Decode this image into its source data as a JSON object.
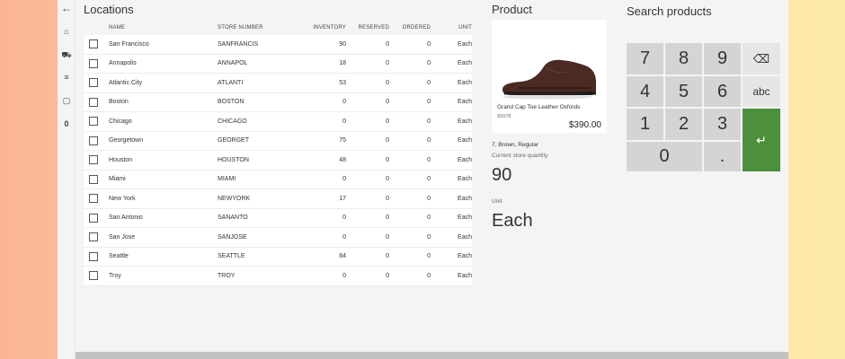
{
  "nav": {
    "back_icon": "arrow-left-icon",
    "items": [
      {
        "icon": "home-icon",
        "glyph": "⌂"
      },
      {
        "icon": "truck-icon",
        "glyph": "⛟"
      },
      {
        "icon": "list-icon",
        "glyph": "≡"
      },
      {
        "icon": "bag-icon",
        "glyph": "▢"
      }
    ],
    "count_label": "0"
  },
  "locations": {
    "title": "Locations",
    "columns": [
      "NAME",
      "STORE NUMBER",
      "INVENTORY",
      "RESERVED",
      "ORDERED",
      "UNIT"
    ],
    "rows": [
      {
        "name": "San Francisco",
        "store": "SANFRANCIS",
        "inventory": "90",
        "reserved": "0",
        "ordered": "0",
        "unit": "Each"
      },
      {
        "name": "Annapolis",
        "store": "ANNAPOL",
        "inventory": "18",
        "reserved": "0",
        "ordered": "0",
        "unit": "Each"
      },
      {
        "name": "Atlantic City",
        "store": "ATLANTI",
        "inventory": "53",
        "reserved": "0",
        "ordered": "0",
        "unit": "Each"
      },
      {
        "name": "Boston",
        "store": "BOSTON",
        "inventory": "0",
        "reserved": "0",
        "ordered": "0",
        "unit": "Each"
      },
      {
        "name": "Chicago",
        "store": "CHICAGO",
        "inventory": "0",
        "reserved": "0",
        "ordered": "0",
        "unit": "Each"
      },
      {
        "name": "Georgetown",
        "store": "GEORGET",
        "inventory": "75",
        "reserved": "0",
        "ordered": "0",
        "unit": "Each"
      },
      {
        "name": "Houston",
        "store": "HOUSTON",
        "inventory": "48",
        "reserved": "0",
        "ordered": "0",
        "unit": "Each"
      },
      {
        "name": "Miami",
        "store": "MIAMI",
        "inventory": "0",
        "reserved": "0",
        "ordered": "0",
        "unit": "Each"
      },
      {
        "name": "New York",
        "store": "NEWYORK",
        "inventory": "17",
        "reserved": "0",
        "ordered": "0",
        "unit": "Each"
      },
      {
        "name": "San Antonio",
        "store": "SANANTO",
        "inventory": "0",
        "reserved": "0",
        "ordered": "0",
        "unit": "Each"
      },
      {
        "name": "San Jose",
        "store": "SANJOSE",
        "inventory": "0",
        "reserved": "0",
        "ordered": "0",
        "unit": "Each"
      },
      {
        "name": "Seattle",
        "store": "SEATTLE",
        "inventory": "84",
        "reserved": "0",
        "ordered": "0",
        "unit": "Each"
      },
      {
        "name": "Troy",
        "store": "TROY",
        "inventory": "0",
        "reserved": "0",
        "ordered": "0",
        "unit": "Each"
      }
    ]
  },
  "product": {
    "title": "Product",
    "name": "Grand Cap Toe Leather Oxfords",
    "code": "92078",
    "price": "$390.00",
    "variant": "7, Brown, Regular",
    "qty_label": "Current store quantity",
    "qty_value": "90",
    "unit_label": "Unit",
    "unit_value": "Each"
  },
  "search": {
    "title": "Search products",
    "keys": {
      "k7": "7",
      "k8": "8",
      "k9": "9",
      "k4": "4",
      "k5": "5",
      "k6": "6",
      "k1": "1",
      "k2": "2",
      "k3": "3",
      "k0": "0",
      "dot": ".",
      "abc": "abc",
      "backspace": "⌫",
      "enter": "↵"
    }
  },
  "colors": {
    "enter_key": "#4d8f3a",
    "key_bg": "#d4d4d4",
    "background_gradient_start": "#fbb596",
    "background_gradient_end": "#fdeaa8"
  }
}
